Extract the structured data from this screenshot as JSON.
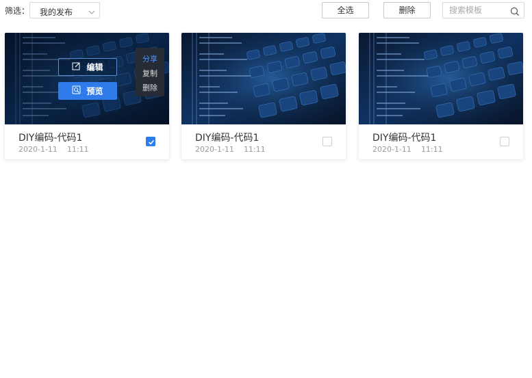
{
  "toolbar": {
    "filter_label": "筛选：",
    "filter_value": "我的发布",
    "select_all_label": "全选",
    "delete_label": "删除",
    "search_placeholder": "搜索模板"
  },
  "cards": [
    {
      "title": "DIY编码-代码1",
      "date": "2020-1-11",
      "time": "11:11",
      "checked": true
    },
    {
      "title": "DIY编码-代码1",
      "date": "2020-1-11",
      "time": "11:11",
      "checked": false
    },
    {
      "title": "DIY编码-代码1",
      "date": "2020-1-11",
      "time": "11:11",
      "checked": false
    }
  ],
  "hover_overlay": {
    "edit_label": "编辑",
    "preview_label": "预览",
    "menu": [
      "分享",
      "复制",
      "删除"
    ]
  },
  "colors": {
    "accent": "#2f7bea",
    "menu_active": "#4f93ff"
  }
}
